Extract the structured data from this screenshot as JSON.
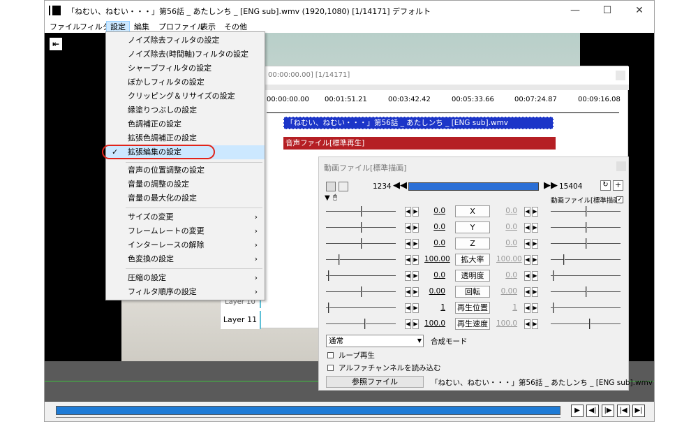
{
  "window": {
    "title": "「ねむい、ねむい・・・」第56話 _ あたしンち _ [ENG sub].wmv (1920,1080)  [1/14171]  デフォルト",
    "minimize": "—",
    "maximize": "☐",
    "close": "✕"
  },
  "menubar": [
    "ファイル",
    "フィルタ",
    "設定",
    "編集",
    "プロファイル",
    "表示",
    "その他"
  ],
  "dropdown": {
    "group1": [
      "ノイズ除去フィルタの設定",
      "ノイズ除去(時間軸)フィルタの設定",
      "シャープフィルタの設定",
      "ぼかしフィルタの設定",
      "クリッピング＆リサイズの設定",
      "縁塗りつぶしの設定",
      "色調補正の設定",
      "拡張色調補正の設定"
    ],
    "highlighted": "拡張編集の設定",
    "group2": [
      "音声の位置調整の設定",
      "音量の調整の設定",
      "音量の最大化の設定"
    ],
    "group3": [
      "サイズの変更",
      "フレームレートの変更",
      "インターレースの解除",
      "色変換の設定"
    ],
    "group4": [
      "圧縮の設定",
      "フィルタ順序の設定"
    ],
    "check_mark": "✓",
    "submenu_arrow": "›"
  },
  "timeline": {
    "position": "00:00:00.00] [1/14171]",
    "ticks": [
      "00:00:00.00",
      "00:01:51.21",
      "00:03:42.42",
      "00:05:33.66",
      "00:07:24.87",
      "00:09:16.08"
    ],
    "video_clip": "「ねむい、ねむい・・・」第56話 _ あたしンち _ [ENG sub].wmv",
    "audio_clip": "音声ファイル[標準再生]",
    "layers": [
      "Layer 10",
      "Layer 11"
    ]
  },
  "properties": {
    "title": "動画ファイル[標準描画]",
    "start_frame": "1234",
    "end_frame": "15404",
    "object_label": "動画ファイル[標準描画]",
    "params": [
      {
        "name": "X",
        "left": "0.0",
        "right": "0.0",
        "lt": 0.5,
        "rt": 0.5
      },
      {
        "name": "Y",
        "left": "0.0",
        "right": "0.0",
        "lt": 0.5,
        "rt": 0.5
      },
      {
        "name": "Z",
        "left": "0.0",
        "right": "0.0",
        "lt": 0.5,
        "rt": 0.5
      },
      {
        "name": "拡大率",
        "left": "100.00",
        "right": "100.00",
        "lt": 0.18,
        "rt": 0.18
      },
      {
        "name": "透明度",
        "left": "0.0",
        "right": "0.0",
        "lt": 0.03,
        "rt": 0.03
      },
      {
        "name": "回転",
        "left": "0.00",
        "right": "0.00",
        "lt": 0.5,
        "rt": 0.5
      },
      {
        "name": "再生位置",
        "left": "1",
        "right": "1",
        "lt": 0.03,
        "rt": 0.03
      },
      {
        "name": "再生速度",
        "left": "100.0",
        "right": "100.0",
        "lt": 0.55,
        "rt": 0.55
      }
    ],
    "blend_mode_value": "通常",
    "blend_mode_label": "合成モード",
    "loop_label": "ループ再生",
    "alpha_label": "アルファチャンネルを読み込む",
    "reference_button": "参照ファイル",
    "reference_file": "「ねむい、ねむい・・・」第56話 _ あたしンち _ [ENG sub].wmv"
  },
  "colors": {
    "accent_blue": "#1c35c8",
    "audio_red": "#b51f24",
    "highlight": "#cce8ff",
    "annotation_red": "#e0241b"
  }
}
